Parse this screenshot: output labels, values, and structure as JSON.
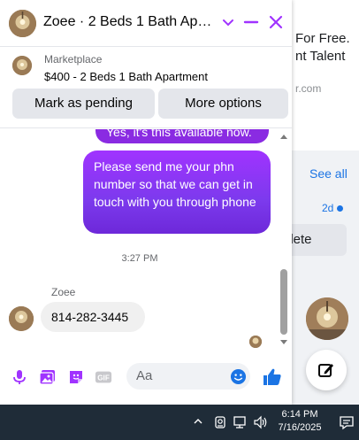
{
  "background": {
    "headline_lines": [
      "For Free.",
      "nt Talent"
    ],
    "url_fragment": "r.com",
    "see_all": "See all",
    "time_ago": "2d",
    "delete_label": "elete"
  },
  "chat": {
    "title": "Zoee · 2 Beds 1 Bath Apartment",
    "accent_color": "#a033ff",
    "listing": {
      "source": "Marketplace",
      "title": "$400 - 2 Beds 1 Bath Apartment",
      "buttons": {
        "pending": "Mark as pending",
        "more": "More options"
      }
    },
    "messages": {
      "outgoing_partial": "Yes, it's this available now.",
      "outgoing": "Please send me your phn number so that we can get in touch with you through phone",
      "time_separator": "3:27 PM",
      "sender_name": "Zoee",
      "incoming": "814-282-3445"
    },
    "composer": {
      "placeholder": "Aa"
    }
  },
  "taskbar": {
    "time": "6:14 PM",
    "date": "7/16/2025"
  }
}
